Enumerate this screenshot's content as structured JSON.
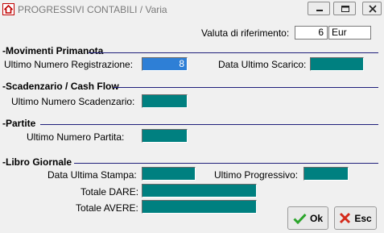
{
  "window": {
    "title": "PROGRESSIVI CONTABILI / Varia",
    "controls": {
      "minimize_icon": "minimize-icon",
      "maximize_icon": "maximize-icon",
      "close_icon": "close-icon"
    }
  },
  "currency": {
    "label": "Valuta di riferimento:",
    "code": "6",
    "name": "Eur"
  },
  "sections": {
    "primanota": {
      "title": "-Movimenti Primanota",
      "ultimo_numero_label": "Ultimo Numero Registrazione:",
      "ultimo_numero_value": "8",
      "data_scarico_label": "Data Ultimo Scarico:",
      "data_scarico_value": ""
    },
    "scadenzario": {
      "title": "-Scadenzario / Cash Flow",
      "ultimo_numero_label": "Ultimo Numero Scadenzario:",
      "ultimo_numero_value": ""
    },
    "partite": {
      "title": "-Partite",
      "ultimo_numero_label": "Ultimo Numero Partita:",
      "ultimo_numero_value": ""
    },
    "libro_giornale": {
      "title": "-Libro Giornale",
      "data_stampa_label": "Data Ultima Stampa:",
      "data_stampa_value": "",
      "ultimo_progressivo_label": "Ultimo Progressivo:",
      "ultimo_progressivo_value": "",
      "totale_dare_label": "Totale DARE:",
      "totale_dare_value": "",
      "totale_avere_label": "Totale AVERE:",
      "totale_avere_value": ""
    }
  },
  "buttons": {
    "ok_label": "Ok",
    "esc_label": "Esc"
  },
  "colors": {
    "field_teal": "#008080",
    "selected_blue": "#2e7fd6",
    "section_line": "#1f1f7a",
    "ok_green": "#2ba52b",
    "esc_red": "#d42a1a"
  }
}
